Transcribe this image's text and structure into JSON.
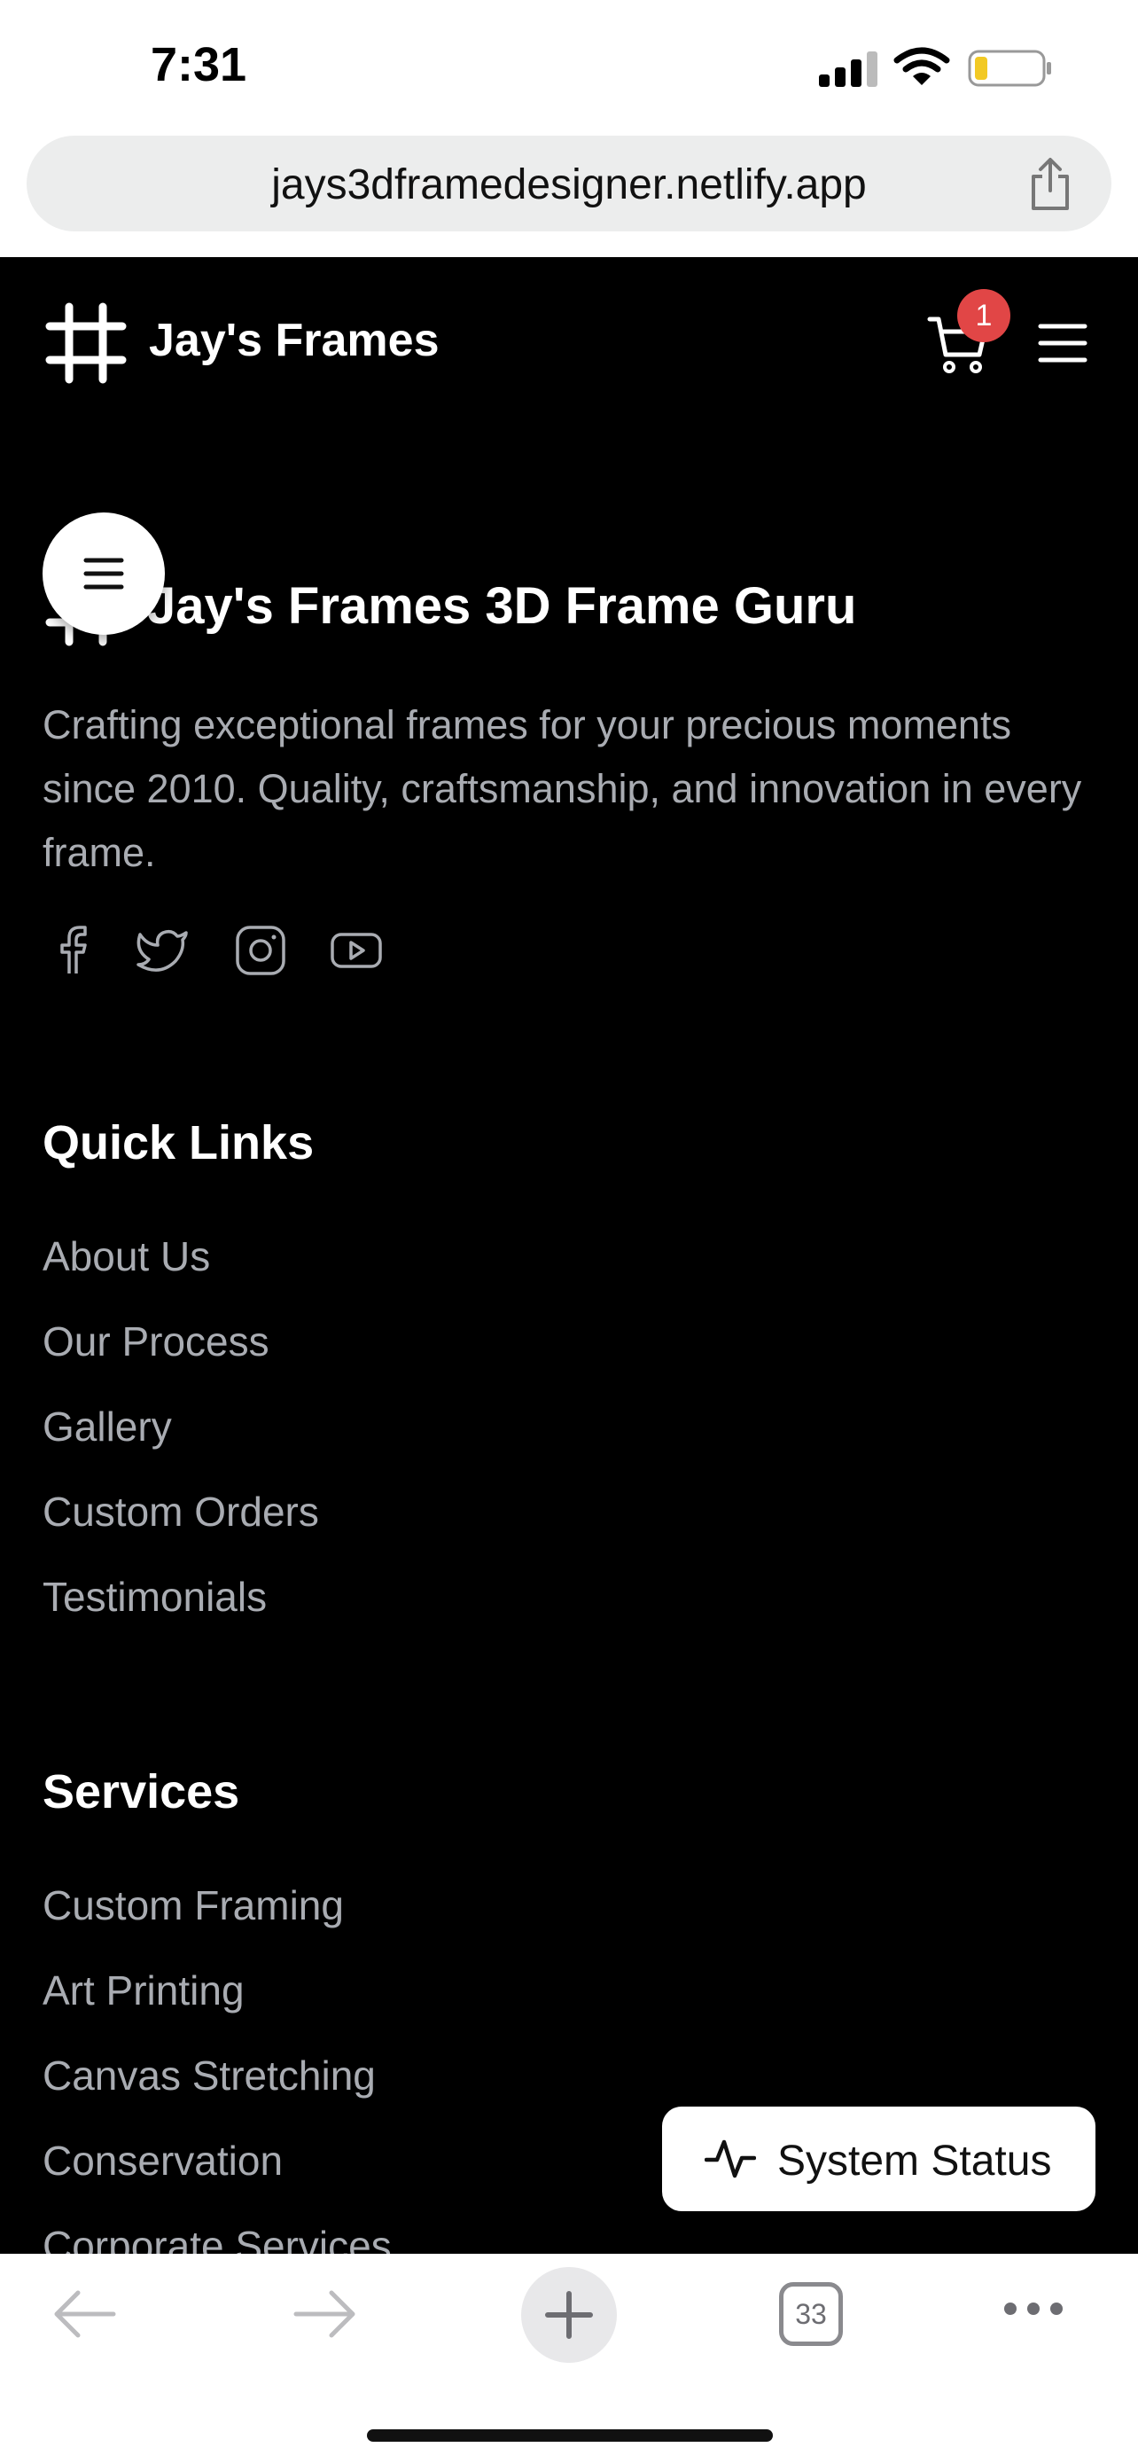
{
  "status_bar": {
    "time": "7:31"
  },
  "browser": {
    "url": "jays3dframedesigner.netlify.app",
    "tab_count": "33"
  },
  "header": {
    "brand": "Jay's Frames",
    "cart_count": "1"
  },
  "footer": {
    "brand": "Jay's Frames 3D Frame Guru",
    "description": "Crafting exceptional frames for your precious moments since 2010. Quality, craftsmanship, and innovation in every frame.",
    "socials": [
      "facebook-icon",
      "twitter-icon",
      "instagram-icon",
      "youtube-icon"
    ]
  },
  "quick_links": {
    "title": "Quick Links",
    "items": [
      "About Us",
      "Our Process",
      "Gallery",
      "Custom Orders",
      "Testimonials"
    ]
  },
  "services": {
    "title": "Services",
    "items": [
      "Custom Framing",
      "Art Printing",
      "Canvas Stretching",
      "Conservation",
      "Corporate Services"
    ]
  },
  "system_status": {
    "label": "System Status"
  },
  "colors": {
    "background": "#000000",
    "badge": "#e14646",
    "muted_text": "#a9acb2"
  }
}
